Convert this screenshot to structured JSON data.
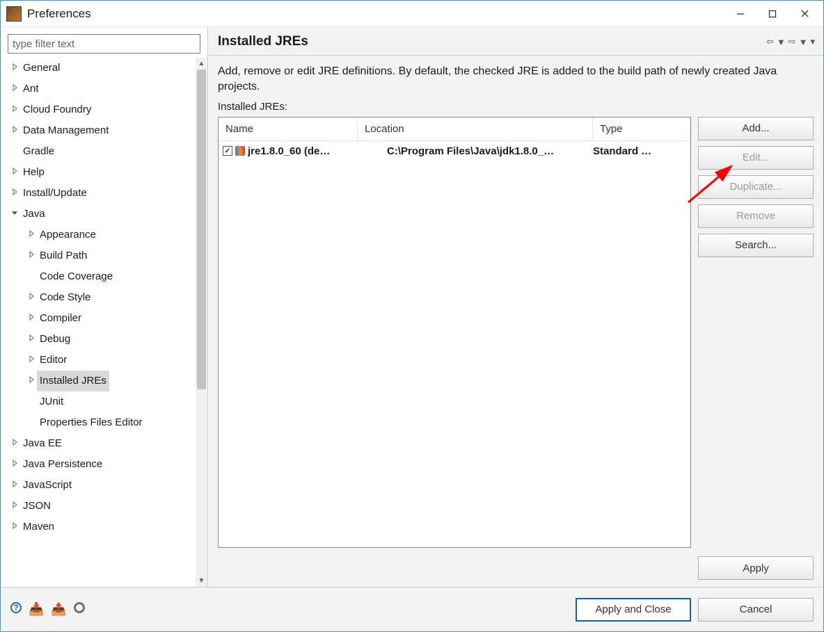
{
  "window": {
    "title": "Preferences"
  },
  "filter": {
    "placeholder": "type filter text"
  },
  "tree": [
    {
      "label": "General",
      "expandable": true,
      "expanded": false,
      "level": 0
    },
    {
      "label": "Ant",
      "expandable": true,
      "expanded": false,
      "level": 0
    },
    {
      "label": "Cloud Foundry",
      "expandable": true,
      "expanded": false,
      "level": 0
    },
    {
      "label": "Data Management",
      "expandable": true,
      "expanded": false,
      "level": 0
    },
    {
      "label": "Gradle",
      "expandable": false,
      "level": 0
    },
    {
      "label": "Help",
      "expandable": true,
      "expanded": false,
      "level": 0
    },
    {
      "label": "Install/Update",
      "expandable": true,
      "expanded": false,
      "level": 0
    },
    {
      "label": "Java",
      "expandable": true,
      "expanded": true,
      "level": 0
    },
    {
      "label": "Appearance",
      "expandable": true,
      "expanded": false,
      "level": 1
    },
    {
      "label": "Build Path",
      "expandable": true,
      "expanded": false,
      "level": 1
    },
    {
      "label": "Code Coverage",
      "expandable": false,
      "level": 1
    },
    {
      "label": "Code Style",
      "expandable": true,
      "expanded": false,
      "level": 1
    },
    {
      "label": "Compiler",
      "expandable": true,
      "expanded": false,
      "level": 1
    },
    {
      "label": "Debug",
      "expandable": true,
      "expanded": false,
      "level": 1
    },
    {
      "label": "Editor",
      "expandable": true,
      "expanded": false,
      "level": 1
    },
    {
      "label": "Installed JREs",
      "expandable": true,
      "expanded": false,
      "level": 1,
      "selected": true
    },
    {
      "label": "JUnit",
      "expandable": false,
      "level": 1
    },
    {
      "label": "Properties Files Editor",
      "expandable": false,
      "level": 1
    },
    {
      "label": "Java EE",
      "expandable": true,
      "expanded": false,
      "level": 0
    },
    {
      "label": "Java Persistence",
      "expandable": true,
      "expanded": false,
      "level": 0
    },
    {
      "label": "JavaScript",
      "expandable": true,
      "expanded": false,
      "level": 0
    },
    {
      "label": "JSON",
      "expandable": true,
      "expanded": false,
      "level": 0
    },
    {
      "label": "Maven",
      "expandable": true,
      "expanded": false,
      "level": 0
    }
  ],
  "page": {
    "title": "Installed JREs",
    "description": "Add, remove or edit JRE definitions. By default, the checked JRE is added to the build path of newly created Java projects.",
    "list_label": "Installed JREs:"
  },
  "table": {
    "columns": {
      "name": "Name",
      "location": "Location",
      "type": "Type"
    },
    "row": {
      "checked": true,
      "name": "jre1.8.0_60 (de…",
      "location": "C:\\Program Files\\Java\\jdk1.8.0_…",
      "type": "Standard …"
    }
  },
  "buttons": {
    "add": "Add...",
    "edit": "Edit...",
    "duplicate": "Duplicate...",
    "remove": "Remove",
    "search": "Search...",
    "apply": "Apply",
    "apply_close": "Apply and Close",
    "cancel": "Cancel"
  }
}
